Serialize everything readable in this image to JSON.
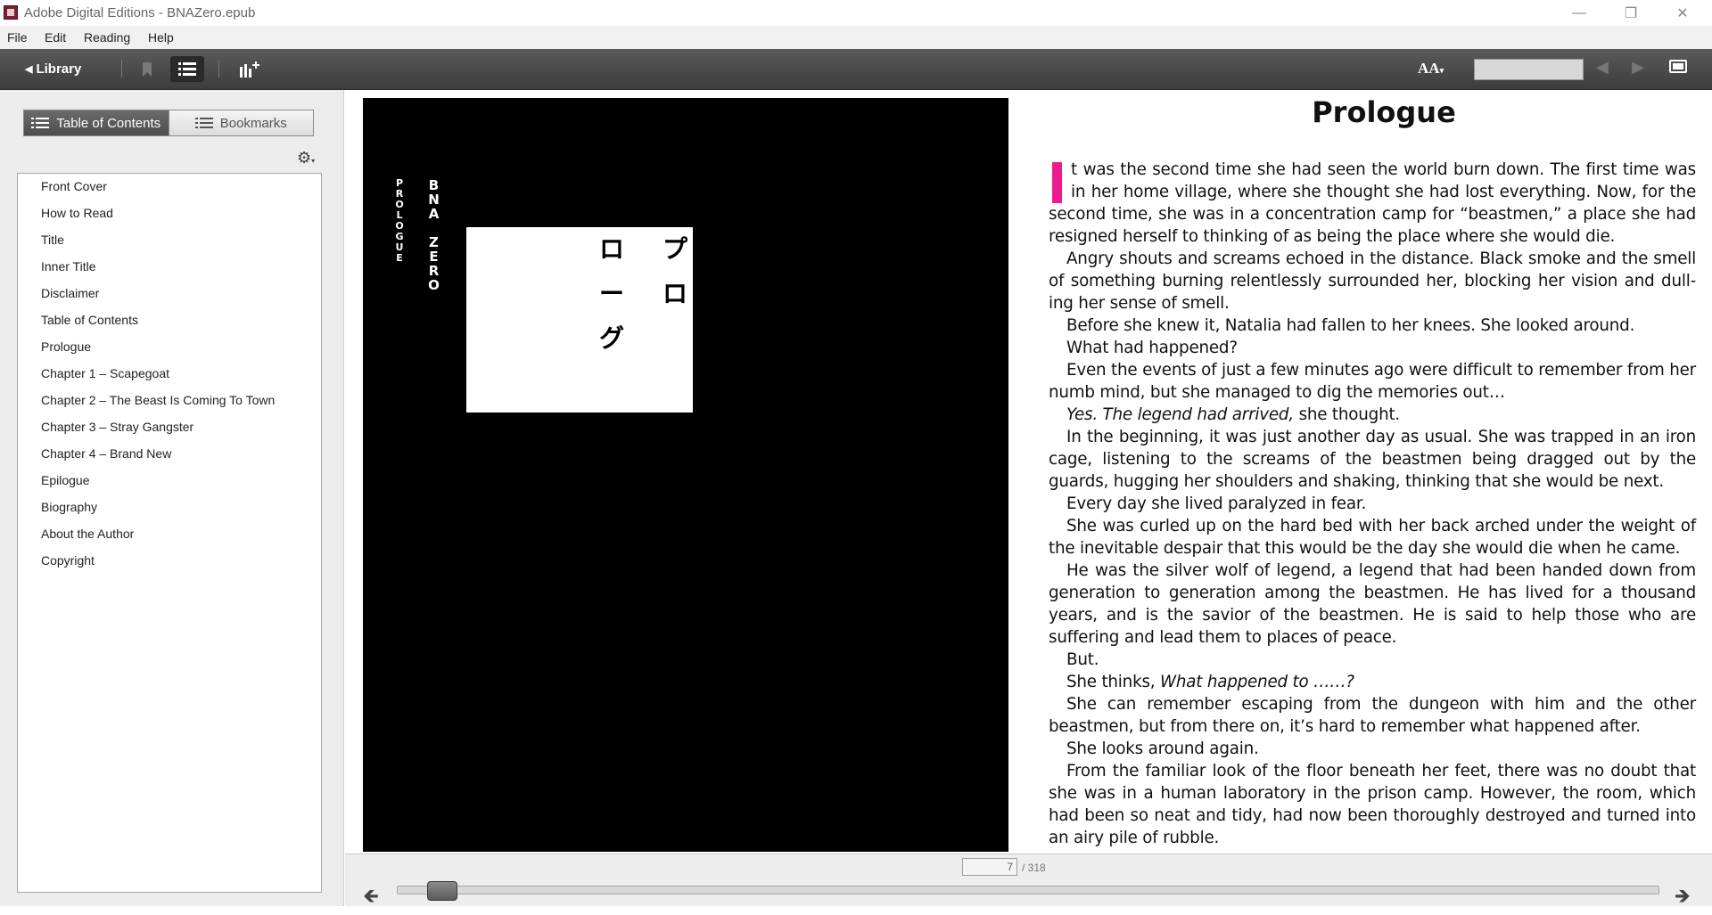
{
  "window": {
    "title": "Adobe Digital Editions - BNAZero.epub",
    "controls": {
      "minimize": "—",
      "maximize": "❐",
      "close": "✕"
    }
  },
  "menu": [
    "File",
    "Edit",
    "Reading",
    "Help"
  ],
  "toolbar": {
    "library_label": "Library",
    "font_size_label": "AA",
    "search_value": "",
    "icons": [
      "bookmark-icon",
      "table-of-contents-icon",
      "add-to-collection-icon",
      "font-size-icon",
      "previous-page-icon",
      "next-page-icon",
      "fullscreen-icon"
    ]
  },
  "left_panel": {
    "tabs": {
      "toc": "Table of Contents",
      "bookmarks": "Bookmarks"
    },
    "toc_items": [
      "Front Cover",
      "How to Read",
      "Title",
      "Inner Title",
      "Disclaimer",
      "Table of Contents",
      "Prologue",
      "Chapter 1 – Scapegoat",
      "Chapter 2 – The Beast Is Coming To Town",
      "Chapter 3 – Stray Gangster",
      "Chapter 4 – Brand New",
      "Epilogue",
      "Biography",
      "About the Author",
      "Copyright"
    ]
  },
  "cover": {
    "vertical_title": "BNA ZERO",
    "vertical_subtitle": "PROLOGUE",
    "japanese_col1": "プロ",
    "japanese_col2": "ローグ"
  },
  "book": {
    "chapter_title": "Prologue",
    "drop_color": "#ec1c8f",
    "p1": "t was the second time she had seen the world burn down. The first time was in her home village, where she thought she had lost everything. Now, for the second time, she was in a concentration camp for “beastmen,” a place she had resigned herself to thinking of as being the place where she would die.",
    "p2": "Angry shouts and screams echoed in the distance. Black smoke and the smell of something burning relentlessly surrounded her, blocking her vision and dull-ing her sense of smell.",
    "p3": "Before she knew it, Natalia had fallen to her knees. She looked around.",
    "p4": "What had happened?",
    "p5": "Even the events of just a few minutes ago were difficult to remember from her numb mind, but she managed to dig the memories out…",
    "p6_italic": "Yes. The legend had arrived,",
    "p6_rest": " she thought.",
    "p7": "In the beginning, it was just another day as usual. She was trapped in an iron cage, listening to the screams of the beastmen being dragged out by the guards, hugging her shoulders and shaking, thinking that she would be next.",
    "p8": "Every day she lived paralyzed in fear.",
    "p9": "She was curled up on the hard bed with her back arched under the weight of the inevitable despair that this would be the day she would die when he came.",
    "p10": "He was the silver wolf of legend, a legend that had been handed down from generation to generation among the beastmen. He has lived for a thousand years, and is the savior of the beastmen. He is said to help those who are suffering and lead them to places of peace.",
    "p11": "But.",
    "p12_start": "She thinks, ",
    "p12_italic": "What happened to ……?",
    "p13": "She can remember escaping from the dungeon with him and the other beastmen, but from there on, it’s hard to remember what happened after.",
    "p14": "She looks around again.",
    "p15": "From the familiar look of the floor beneath her feet, there was no doubt that she was in a human laboratory in the prison camp. However, the room, which had been so neat and tidy, had now been thoroughly destroyed and turned into an airy pile of rubble."
  },
  "navigation": {
    "current_page": "7",
    "total_pages": "/ 318",
    "progress_fraction": 0.022
  }
}
